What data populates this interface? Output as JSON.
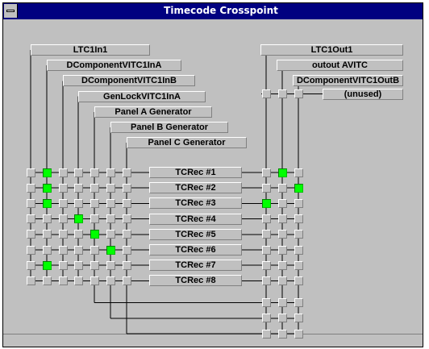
{
  "window": {
    "title": "Timecode Crosspoint"
  },
  "inputs": [
    {
      "label": "LTC1In1"
    },
    {
      "label": "DComponentVITC1InA"
    },
    {
      "label": "DComponentVITC1InB"
    },
    {
      "label": "GenLockVITC1InA"
    },
    {
      "label": "Panel A Generator"
    },
    {
      "label": "Panel B Generator"
    },
    {
      "label": "Panel C Generator"
    }
  ],
  "outputs": [
    {
      "label": "LTC1Out1"
    },
    {
      "label": "outout AVITC"
    },
    {
      "label": "DComponentVITC1OutB"
    }
  ],
  "unused_label": "(unused)",
  "readers": [
    {
      "label": "TCRec #1",
      "active_input": 1,
      "active_output": 1
    },
    {
      "label": "TCRec #2",
      "active_input": 1,
      "active_output": 2
    },
    {
      "label": "TCRec #3",
      "active_input": 1,
      "active_output": 0
    },
    {
      "label": "TCRec #4",
      "active_input": 3,
      "active_output": null
    },
    {
      "label": "TCRec #5",
      "active_input": 4,
      "active_output": null
    },
    {
      "label": "TCRec #6",
      "active_input": 5,
      "active_output": null
    },
    {
      "label": "TCRec #7",
      "active_input": 1,
      "active_output": null
    },
    {
      "label": "TCRec #8",
      "active_input": null,
      "active_output": null
    }
  ],
  "extra_rows": 3,
  "colors": {
    "active": "#00ff00",
    "face": "#c0c0c0",
    "title": "#000080"
  }
}
